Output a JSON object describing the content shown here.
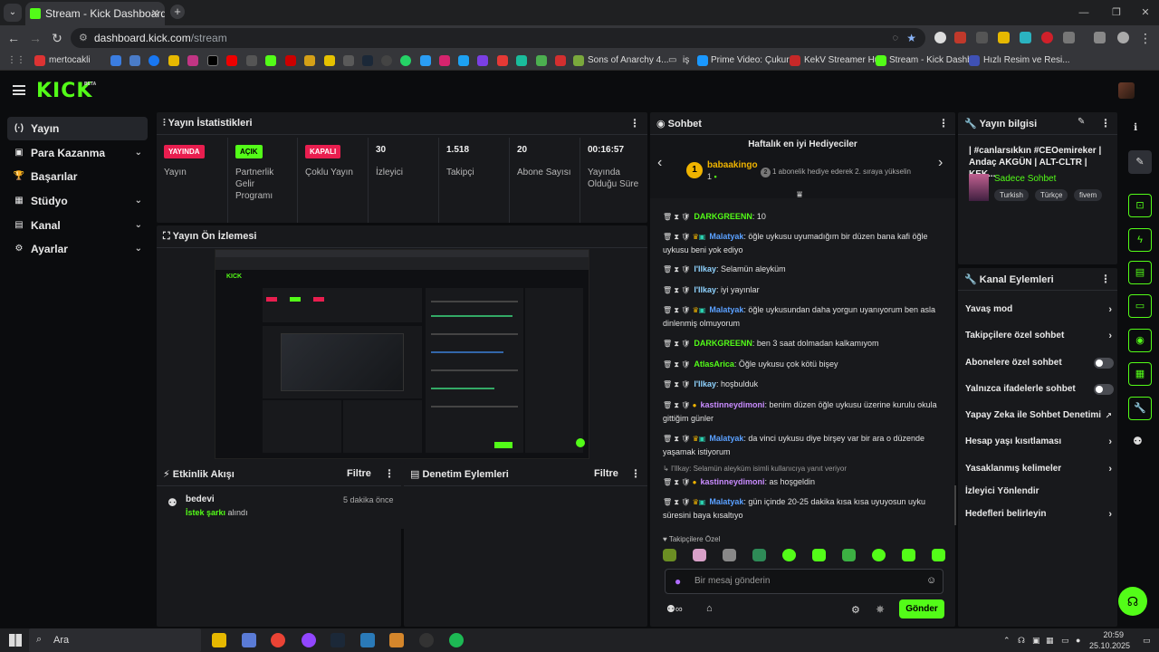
{
  "browser": {
    "tab_title": "Stream - Kick Dashboard",
    "url_host": "dashboard.kick.com",
    "url_path": "/stream",
    "bookmarks": [
      "mertocakli",
      "Sons of Anarchy 4...",
      "iş",
      "Prime Video: Çukur...",
      "KekV Streamer Hub",
      "Stream - Kick Dashb...",
      "Hızlı Resim ve Resi..."
    ]
  },
  "app": {
    "logo": "KICK",
    "beta": "BETA",
    "sidebar": [
      {
        "icon": "(·)",
        "label": "Yayın",
        "chevron": ""
      },
      {
        "icon": "▣",
        "label": "Para Kazanma",
        "chevron": "⌄"
      },
      {
        "icon": "🏆",
        "label": "Başarılar",
        "chevron": ""
      },
      {
        "icon": "▦",
        "label": "Stüdyo",
        "chevron": "⌄"
      },
      {
        "icon": "▤",
        "label": "Kanal",
        "chevron": "⌄"
      },
      {
        "icon": "⚙",
        "label": "Ayarlar",
        "chevron": "⌄"
      }
    ]
  },
  "stats": {
    "title": "Yayın İstatistikleri",
    "columns": [
      {
        "badge": "YAYINDA",
        "badge_color": "#e91e4f",
        "label": "Yayın"
      },
      {
        "badge": "AÇIK",
        "badge_color": "#53fc18",
        "label": "Partnerlik Gelir Programı"
      },
      {
        "badge": "KAPALI",
        "badge_color": "#e91e4f",
        "label": "Çoklu Yayın"
      },
      {
        "value": "30",
        "label": "İzleyici"
      },
      {
        "value": "1.518",
        "label": "Takipçi"
      },
      {
        "value": "20",
        "label": "Abone Sayısı"
      },
      {
        "value": "00:16:57",
        "label": "Yayında Olduğu Süre"
      }
    ]
  },
  "preview": {
    "title": "Yayın Ön İzlemesi"
  },
  "activity": {
    "title": "Etkinlik Akışı",
    "filter": "Filtre",
    "item": {
      "user": "bedevi",
      "time": "5 dakika önce",
      "highlight": "İstek şarkı",
      "rest": " alındı"
    }
  },
  "moderation": {
    "title": "Denetim Eylemleri",
    "filter": "Filtre"
  },
  "chat": {
    "title": "Sohbet",
    "gifters_title": "Haftalık en iyi Hediyeciler",
    "gifter": {
      "rank": "1",
      "name": "babaakingo",
      "count": "1",
      "note": "1 abonelik hediye ederek 2. sıraya yükselin"
    },
    "messages": [
      {
        "user": "DARKGREENN",
        "color": "#53fc18",
        "text": ": 10",
        "badges": "plain"
      },
      {
        "user": "Malatyak",
        "color": "#5aa0ff",
        "text": ": öğle uykusu uyumadığım bir düzen bana kafi öğle uykusu beni yok ediyo",
        "badges": "crown"
      },
      {
        "user": "I'Ilkay",
        "color": "#8fd3ff",
        "text": ": Selamün aleyküm",
        "badges": "plain"
      },
      {
        "user": "I'Ilkay",
        "color": "#8fd3ff",
        "text": ": iyi yayınlar",
        "badges": "plain"
      },
      {
        "user": "Malatyak",
        "color": "#5aa0ff",
        "text": ": öğle uykusundan daha yorgun uyanıyorum ben asla dinlenmiş olmuyorum",
        "badges": "crown"
      },
      {
        "user": "DARKGREENN",
        "color": "#53fc18",
        "text": ": ben 3 saat dolmadan kalkamıyom",
        "badges": "plain"
      },
      {
        "user": "AtlasArica",
        "color": "#53fc18",
        "text": ": Öğle uykusu çok kötü bişey",
        "badges": "plain"
      },
      {
        "user": "I'Ilkay",
        "color": "#8fd3ff",
        "text": ": hoşbulduk",
        "badges": "plain"
      },
      {
        "user": "kastinneydimoni",
        "color": "#c98cff",
        "text": ": benim düzen öğle uykusu üzerine kurulu okula gittiğim günler",
        "badges": "gift"
      },
      {
        "user": "Malatyak",
        "color": "#5aa0ff",
        "text": ": da vinci uykusu diye birşey var bir ara o düzende yaşamak istiyorum",
        "badges": "crown"
      },
      {
        "user": "kastinneydimoni",
        "color": "#c98cff",
        "text": ": as hoşgeldin",
        "badges": "gift",
        "reply": "I'Ilkay: Selamün aleyküm isimli kullanıcıya yanıt veriyor"
      },
      {
        "user": "Malatyak",
        "color": "#5aa0ff",
        "text": ": gün içinde 20-25 dakika kısa kısa uyuyosun uyku süresini baya kısaltıyo",
        "badges": "crown"
      }
    ],
    "followers_only": "Takipçilere Özel",
    "input_placeholder": "Bir mesaj gönderin",
    "send": "Gönder"
  },
  "stream_info": {
    "title": "Yayın bilgisi",
    "stream_title": "| #canlarsıkkın #CEOemireker | Andaç AKGÜN | ALT-CLTR | KEK...",
    "category": "Sadece Sohbet",
    "tags": [
      "Turkish",
      "Türkçe",
      "fivem"
    ]
  },
  "channel_actions": {
    "title": "Kanal Eylemleri",
    "items": [
      {
        "label": "Yavaş mod",
        "control": "chevron"
      },
      {
        "label": "Takipçilere özel sohbet",
        "control": "chevron"
      },
      {
        "label": "Abonelere özel sohbet",
        "control": "toggle"
      },
      {
        "label": "Yalnızca ifadelerle sohbet",
        "control": "toggle"
      },
      {
        "label": "Yapay Zeka ile Sohbet Denetimi",
        "control": "external"
      },
      {
        "label": "Hesap yaşı kısıtlaması",
        "control": "chevron"
      },
      {
        "label": "Yasaklanmış kelimeler",
        "control": "chevron"
      },
      {
        "label": "İzleyici Yönlendir",
        "control": "none"
      },
      {
        "label": "Hedefleri belirleyin",
        "control": "chevron"
      }
    ]
  },
  "taskbar": {
    "search": "Ara",
    "time": "20:59",
    "date": "25.10.2025"
  }
}
